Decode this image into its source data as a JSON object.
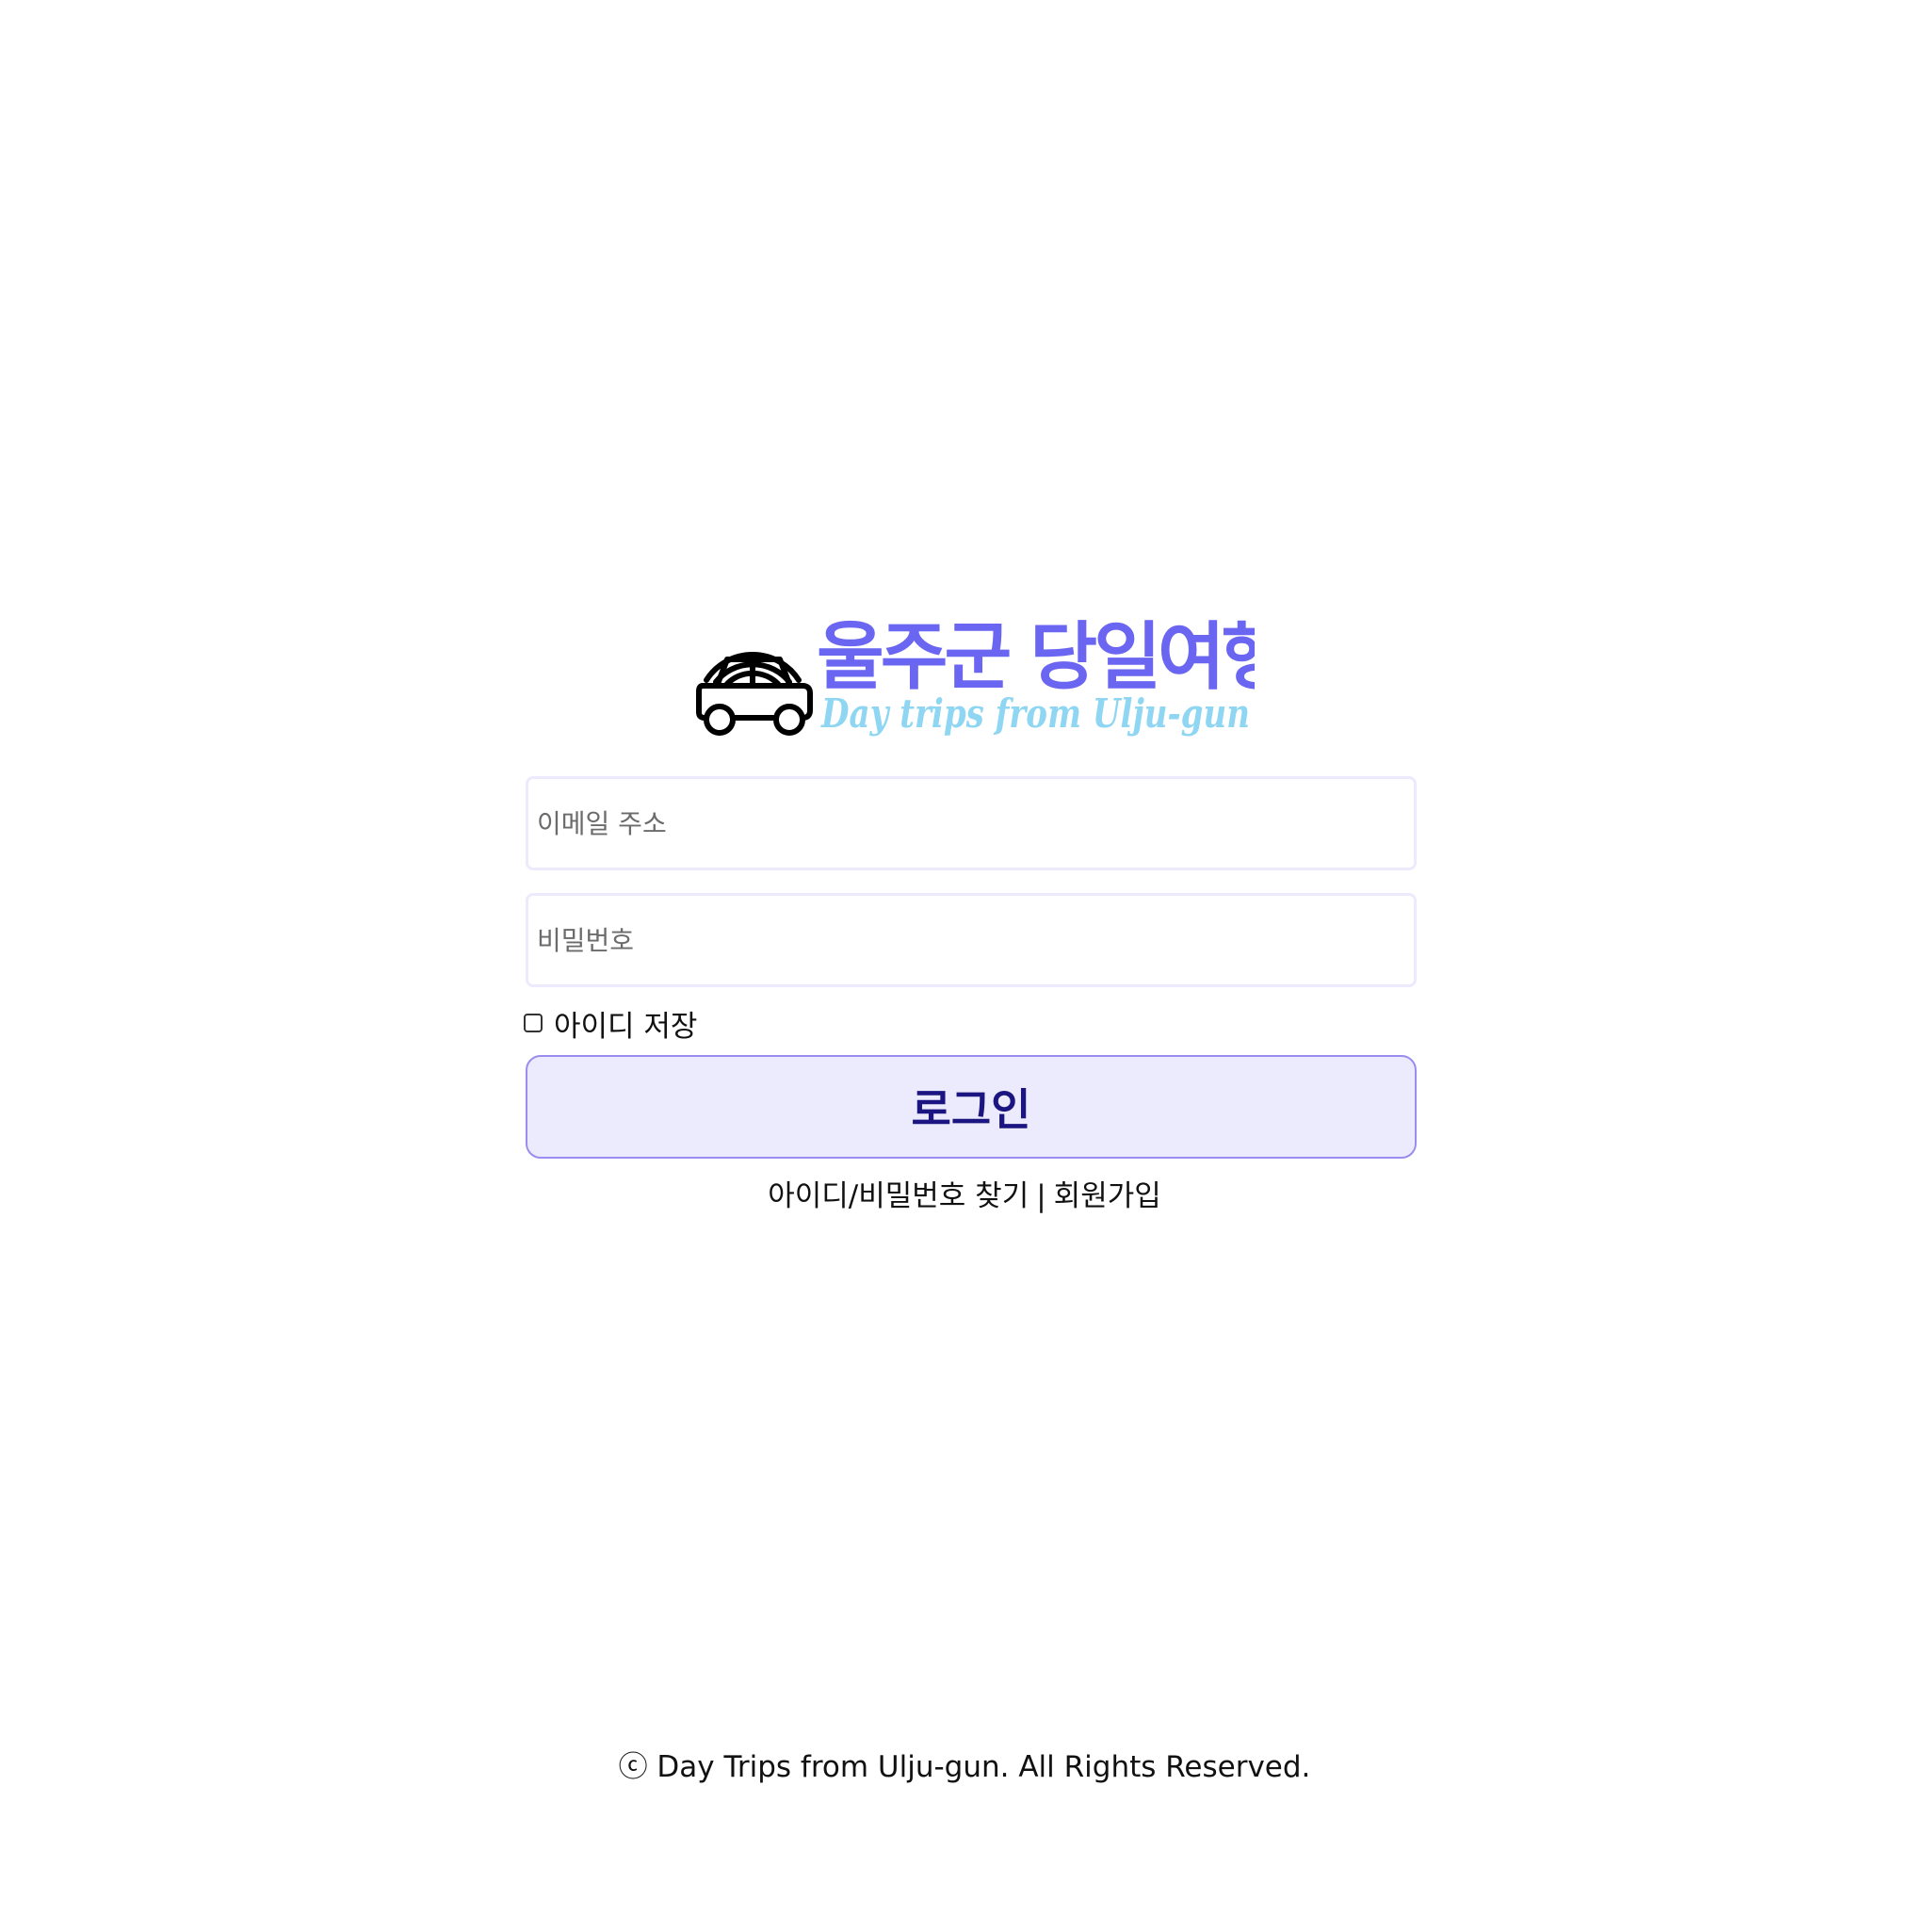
{
  "brand": {
    "title_ko": "울주군 당일여행",
    "title_en": "Day trips from Ulju-gun",
    "logo_icon": "car-with-rainbow-icon",
    "colors": {
      "title_ko": "#6a66f2",
      "title_en": "#8fd6f2"
    }
  },
  "form": {
    "email_placeholder": "이메일 주소",
    "email_value": "",
    "password_placeholder": "비밀번호",
    "password_value": "",
    "remember_label": "아이디 저장",
    "remember_checked": false,
    "login_label": "로그인"
  },
  "links": {
    "find_account": "아이디/비밀번호 찾기",
    "separator": "|",
    "signup": "회원가입"
  },
  "footer": {
    "copyright": "ⓒ Day Trips from Ulju-gun. All Rights Reserved."
  },
  "colors": {
    "login_button_bg": "#ecebfd",
    "login_button_border": "#9b8cf0",
    "login_button_text": "#1b1581",
    "input_border": "#eeeafd"
  }
}
